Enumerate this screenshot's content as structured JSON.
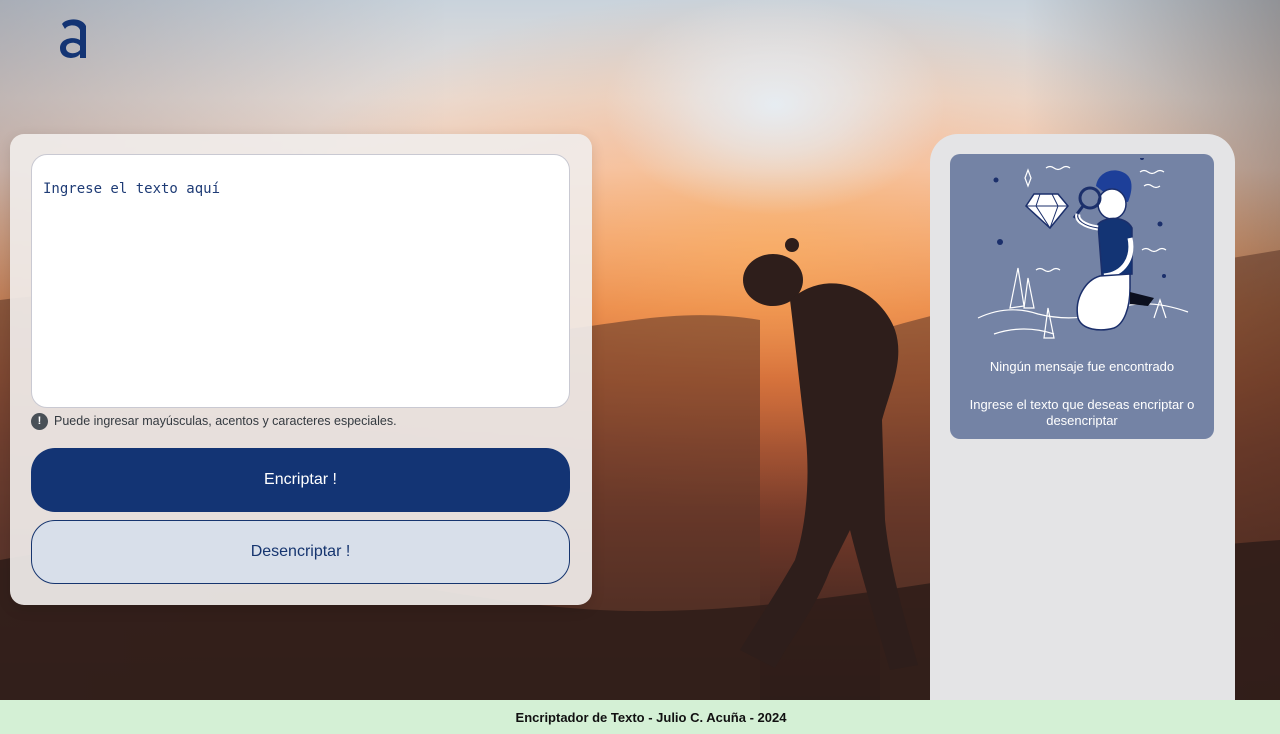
{
  "logo": {
    "glyph": "a",
    "color": "#133474"
  },
  "input": {
    "placeholder": "Ingrese el texto aquí",
    "value": ""
  },
  "hint": {
    "icon": "exclamation-circle-icon",
    "icon_glyph": "!",
    "text": "Puede ingresar mayúsculas, acentos y caracteres especiales."
  },
  "buttons": {
    "encrypt_label": "Encriptar !",
    "decrypt_label": "Desencriptar !"
  },
  "output": {
    "illustration": "person-with-magnifier-diamond-illustration",
    "title": "Ningún mensaje fue encontrado",
    "subtitle": "Ingrese el texto que deseas encriptar o desencriptar"
  },
  "footer": {
    "text": "Encriptador de Texto - Julio C. Acuña - 2024"
  },
  "colors": {
    "primary": "#133474",
    "secondary_bg": "#d8dfea",
    "card_bg": "#7483a5",
    "panel_bg": "#e4e4e6",
    "footer_bg": "#d4f0d5"
  }
}
